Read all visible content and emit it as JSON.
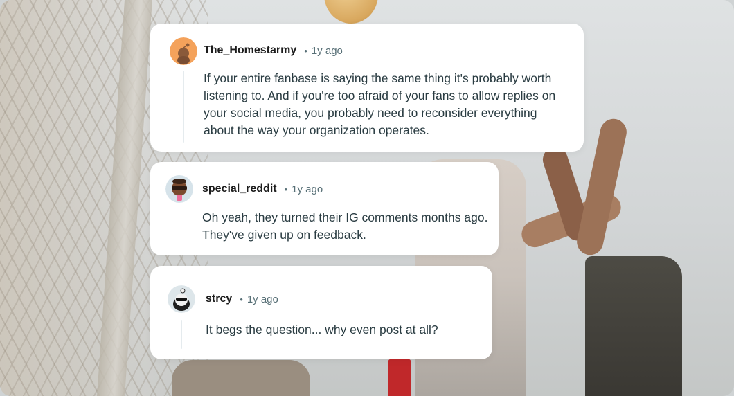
{
  "comments": [
    {
      "username": "The_Homestarmy",
      "separator": "•",
      "time": "1y ago",
      "body": "If your entire fanbase is saying the same thing it's probably worth listening to. And if you're too afraid of your fans to allow replies on your social media, you probably need to reconsider everything about the way your organization operates.",
      "avatar_color": "#f4a25b"
    },
    {
      "username": "special_reddit",
      "separator": "•",
      "time": "1y ago",
      "body": "Oh yeah, they turned their IG comments months ago. They've given up on feedback.",
      "avatar_color": "#d6e3ea"
    },
    {
      "username": "strcy",
      "separator": "•",
      "time": "1y ago",
      "body": "It begs the question... why even post at all?",
      "avatar_color": "#dde6ea"
    }
  ],
  "colors": {
    "card_bg": "#ffffff",
    "username": "#1c1c1c",
    "meta": "#576f76",
    "body": "#2a3c42"
  }
}
